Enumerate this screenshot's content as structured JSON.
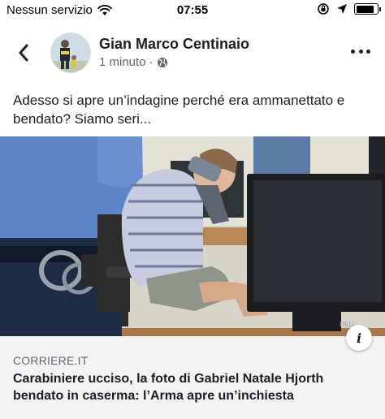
{
  "status_bar": {
    "carrier": "Nessun servizio",
    "time": "07:55",
    "battery_level": 0.85
  },
  "post": {
    "author": "Gian Marco Centinaio",
    "timestamp": "1 minuto",
    "text": "Adesso si apre un’indagine perché era ammanettato e bendato? Siamo seri...",
    "icons": {
      "back": "chevron-left-icon",
      "more": "more-horizontal-icon",
      "privacy": "globe-icon"
    }
  },
  "link_preview": {
    "domain": "CORRIERE.IT",
    "title": "Carabiniere ucciso, la foto di Gabriel Natale Hjorth bendato in caserma: l’Arma apre un’inchiesta",
    "info_label": "i"
  }
}
